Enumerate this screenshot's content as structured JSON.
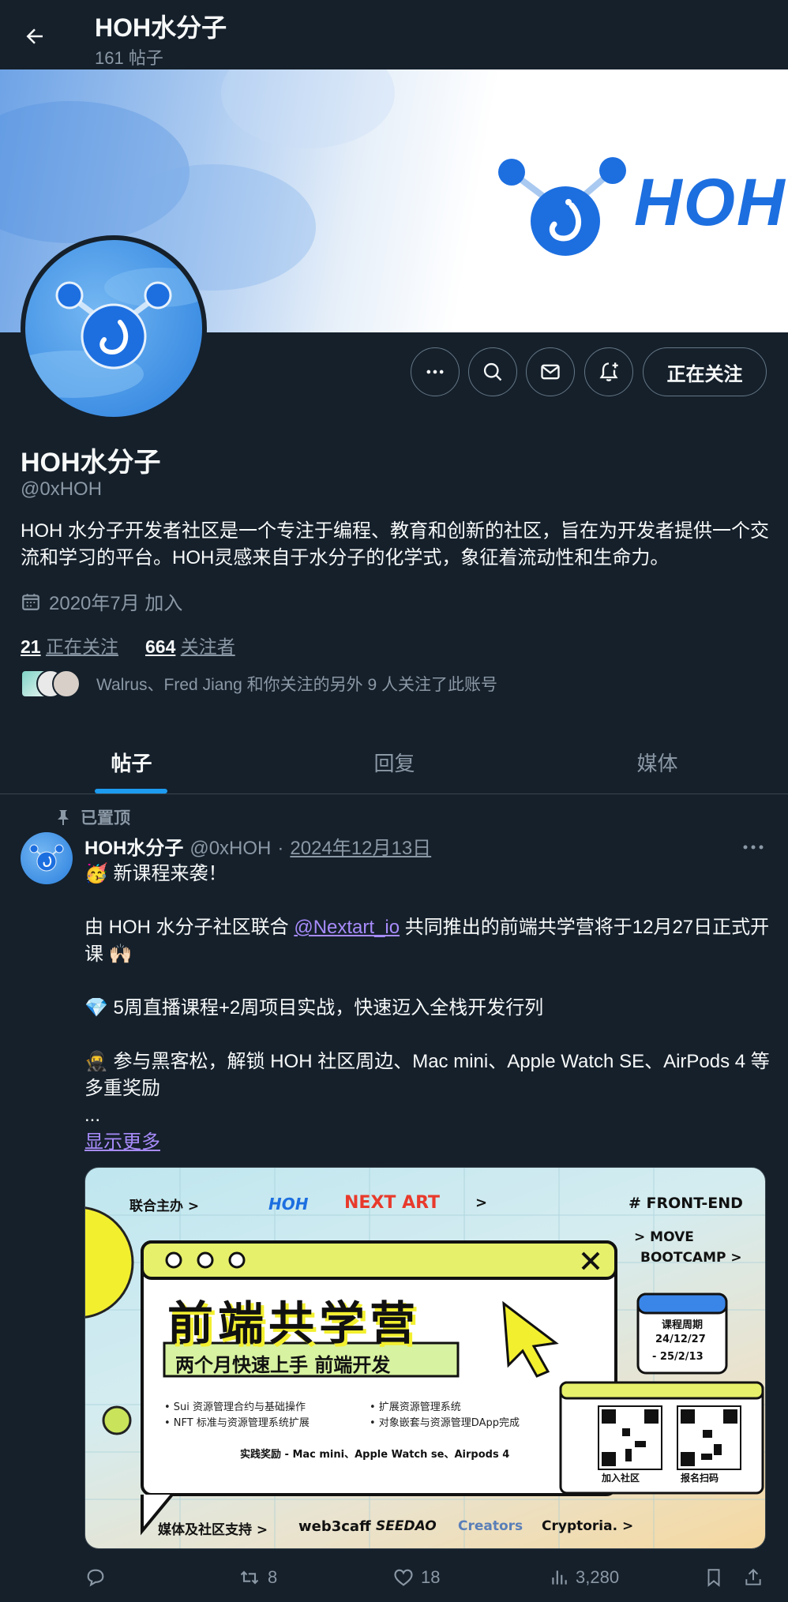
{
  "header": {
    "title": "HOH水分子",
    "subtitle": "161 帖子"
  },
  "banner": {
    "brand_text": "HOH"
  },
  "actions": {
    "follow_label": "正在关注"
  },
  "profile": {
    "name": "HOH水分子",
    "handle": "@0xHOH",
    "bio": "HOH 水分子开发者社区是一个专注于编程、教育和创新的社区，旨在为开发者提供一个交流和学习的平台。HOH灵感来自于水分子的化学式，象征着流动性和生命力。",
    "joined": "2020年7月 加入",
    "following_count": "21",
    "following_label": "正在关注",
    "followers_count": "664",
    "followers_label": "关注者",
    "followed_by": "Walrus、Fred Jiang 和你关注的另外 9 人关注了此账号"
  },
  "tabs": [
    {
      "label": "帖子"
    },
    {
      "label": "回复"
    },
    {
      "label": "媒体"
    }
  ],
  "post": {
    "pinned_label": "已置顶",
    "author": "HOH水分子",
    "handle": "@0xHOH",
    "separator": "·",
    "date": "2024年12月13日",
    "line1": "🥳 新课程来袭！",
    "line2_pre": "由 HOH 水分子社区联合 ",
    "mention": "@Nextart_io",
    "line2_post": " 共同推出的前端共学营将于12月27日正式开课 🙌🏻",
    "line3": "💎 5周直播课程+2周项目实战，快速迈入全栈开发行列",
    "line4": "🥷 参与黑客松，解锁 HOH 社区周边、Mac mini、Apple Watch SE、AirPods 4 等多重奖励",
    "ellipsis": "...",
    "show_more": "显示更多",
    "retweets": "8",
    "likes": "18",
    "views": "3,280"
  },
  "media": {
    "organizer_label": "联合主办 >",
    "hoh": "HOH",
    "nextart": "NEXT ART",
    "arrow": ">",
    "tag": "# FRONT-END",
    "move1": "> MOVE",
    "move2": "BOOTCAMP >",
    "main_title": "前端共学营",
    "subtitle": "两个月快速上手 前端开发",
    "bullet1": "• Sui 资源管理合约与基础操作",
    "bullet2": "• NFT 标准与资源管理系统扩展",
    "bullet3": "• 扩展资源管理系统",
    "bullet4": "• 对象嵌套与资源管理DApp完成",
    "reward": "实践奖励 - Mac mini、Apple Watch se、Airpods 4",
    "period_title": "课程周期",
    "period_1": "24/12/27",
    "period_2": "- 25/2/13",
    "qr1": "加入社区",
    "qr2": "报名扫码",
    "support": "媒体及社区支持 >",
    "sponsor1": "web3caff",
    "sponsor2": "SEEDAO",
    "sponsor3": "Creators",
    "sponsor4": "Cryptoria.",
    "sponsor_arrow": ">"
  },
  "colors": {
    "accent": "#1d9bf0",
    "bg": "#15202b",
    "muted": "#8b98a5",
    "brand": "#1d6fe0"
  }
}
